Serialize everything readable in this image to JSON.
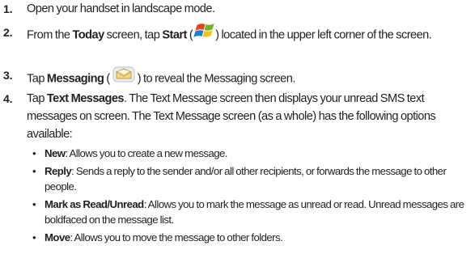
{
  "steps": [
    {
      "number": "1.",
      "text": "Open your handset in landscape mode."
    },
    {
      "number": "2.",
      "pre": "From the ",
      "bold1": "Today",
      "mid": " screen, tap ",
      "bold2": "Start",
      "open": " (",
      "icon": "windows-start-icon",
      "post": ") located in the upper left corner of the screen."
    },
    {
      "number": "3.",
      "pre": "Tap ",
      "bold1": "Messaging",
      "open": " (",
      "icon": "messaging-envelope-icon",
      "post": ") to reveal the Messaging screen."
    },
    {
      "number": "4.",
      "pre": "Tap ",
      "bold1": "Text Messages",
      "post": ". The Text Message screen then displays your unread SMS text messages on screen. The Text Message screen (as a whole) has the following options available:"
    }
  ],
  "options": [
    {
      "term": "New",
      "desc": ": Allows you to create a new message."
    },
    {
      "term": "Reply",
      "desc": ": Sends a reply to the sender and/or all other recipients, or forwards the message to other people."
    },
    {
      "term": "Mark as Read/Unread",
      "desc": ": Allows you to mark the message as unread or read. Unread messages are boldfaced on the message list."
    },
    {
      "term": "Move",
      "desc": ": Allows you to move the message to other folders."
    }
  ],
  "bullet_char": "•"
}
